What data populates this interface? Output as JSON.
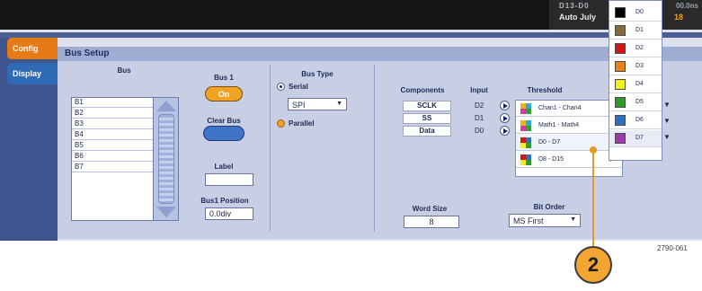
{
  "status": {
    "line1": "D13-D0",
    "line2": "Auto  July",
    "year_fragment": "18",
    "zoom_fragment": "00.0ns"
  },
  "tabs": [
    {
      "label": "Config",
      "active": true
    },
    {
      "label": "Display",
      "active": false
    }
  ],
  "panel": {
    "title": "Bus Setup",
    "bus_header": "Bus",
    "bus_list": [
      "B1",
      "B2",
      "B3",
      "B4",
      "B5",
      "B6",
      "B7"
    ],
    "bus1_label": "Bus 1",
    "bus1_on_label": "On",
    "clear_bus_label": "Clear Bus",
    "label_caption": "Label",
    "label_value": "",
    "bus1_position_label": "Bus1 Position",
    "bus1_position_value": "0.0div",
    "bus_type_header": "Bus Type",
    "serial_label": "Serial",
    "parallel_label": "Parallel",
    "serial_type_value": "SPI",
    "components_header": "Components",
    "input_header": "Input",
    "threshold_header": "Threshold",
    "components": [
      {
        "name": "SCLK",
        "input": "D2"
      },
      {
        "name": "SS",
        "input": "D1"
      },
      {
        "name": "Data",
        "input": "D0"
      }
    ],
    "word_size_label": "Word Size",
    "word_size_value": "8",
    "bit_order_label": "Bit Order",
    "bit_order_value": "MS First"
  },
  "threshold_menu": [
    {
      "label": "Chan1 - Chan4",
      "has_submenu": true
    },
    {
      "label": "Math1 - Math4",
      "has_submenu": true
    },
    {
      "label": "D0 - D7",
      "has_submenu": true
    },
    {
      "label": "D8 - D15",
      "has_submenu": true
    }
  ],
  "digital_menu": [
    {
      "label": "D0",
      "color": "#000000"
    },
    {
      "label": "D1",
      "color": "#8a6a3c"
    },
    {
      "label": "D2",
      "color": "#d01818"
    },
    {
      "label": "D3",
      "color": "#ea7f1c"
    },
    {
      "label": "D4",
      "color": "#f2ee20"
    },
    {
      "label": "D5",
      "color": "#2e9a2e"
    },
    {
      "label": "D6",
      "color": "#2f6fc0"
    },
    {
      "label": "D7",
      "color": "#9a3da8"
    }
  ],
  "callout": {
    "number": "2"
  },
  "figure_number": "2790-061"
}
